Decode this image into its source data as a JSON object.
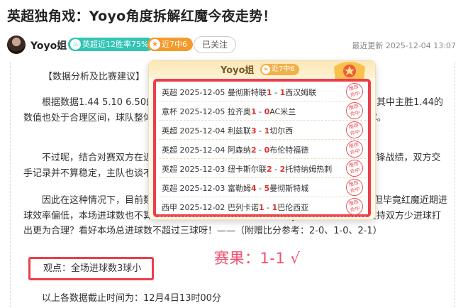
{
  "article": {
    "title": "英超独角戏：Yoyo角度拆解红魔今夜走势！",
    "author": {
      "name": "Yoyo姐",
      "badge_win_rate": "英超近12胜率75%",
      "badge_streak": "近7中6",
      "follow_label": "已关注"
    },
    "updated_label": "最近更新",
    "updated_time": "2025-12-04 13:07",
    "heading": "【数据分析及比赛建议】",
    "para1": "根据数据1.44 5.10 6.50的初盘分析，曼彻斯特联在主场获得了不错的信心支撑？其中主胜1.44的数值也处于合理区间，球队整体状态有所回勇，因此XX认为今仪数据方对曼联有着支撑。",
    "para2": "不过呢，结合对赛双方在近期的交手战绩来看，曼联有时候只能够取得5胜5负的交锋战绩，双方交手记录并不算稳定，主队也谈不上有明显上风？",
    "para3": "因此在这种情况下，目前数据对曼联的主场有着一定的支撑力度，确实有所体现。但毕竟红魔近期进球效率偏低，本场进球数也不算特别稳定，因此出于稳妥考虑，Yoyo认为今仪或许从支持双方少进球打出更为合理？看好本场总进球数不超过三球呀！——（附赠比分参考：2-0、1-0、2-1）",
    "viewpoint": "观点：全场进球数3球小",
    "cutoff": "以上各数据截止时间为：12月4日13时00分",
    "result": "赛果：1-1 √"
  },
  "popup": {
    "name": "Yoyo姐",
    "streak": "近7中6",
    "stamp_text": "推荐命中",
    "matches": [
      {
        "league": "英超",
        "date": "2025-12-05",
        "home": "曼彻斯特联",
        "home_score": "1",
        "away_score": "1",
        "away": "西汉姆联"
      },
      {
        "league": "意杯",
        "date": "2025-12-05",
        "home": "拉齐奥",
        "home_score": "1",
        "away_score": "0",
        "away": "AC米兰"
      },
      {
        "league": "英超",
        "date": "2025-12-04",
        "home": "利兹联",
        "home_score": "3",
        "away_score": "1",
        "away": "切尔西"
      },
      {
        "league": "英超",
        "date": "2025-12-04",
        "home": "阿森纳",
        "home_score": "2",
        "away_score": "0",
        "away": "布伦特福德"
      },
      {
        "league": "英超",
        "date": "2025-12-03",
        "home": "纽卡斯尔联",
        "home_score": "2",
        "away_score": "2",
        "away": "托特纳姆热刺"
      },
      {
        "league": "英超",
        "date": "2025-12-03",
        "home": "富勒姆",
        "home_score": "4",
        "away_score": "5",
        "away": "曼彻斯特城"
      },
      {
        "league": "西甲",
        "date": "2025-12-02",
        "home": "巴列卡诺",
        "home_score": "1",
        "away_score": "1",
        "away": "巴伦西亚"
      }
    ]
  },
  "icons": {
    "win_rate": "fire-icon",
    "streak": "star-icon",
    "trophy": "trophy-icon",
    "stamp": "hit-stamp-icon"
  },
  "colors": {
    "highlight_red": "#ee3d4a",
    "result_pink": "#f0506e",
    "badge_teal": "#32c4b4",
    "badge_orange": "#f39a2a"
  }
}
